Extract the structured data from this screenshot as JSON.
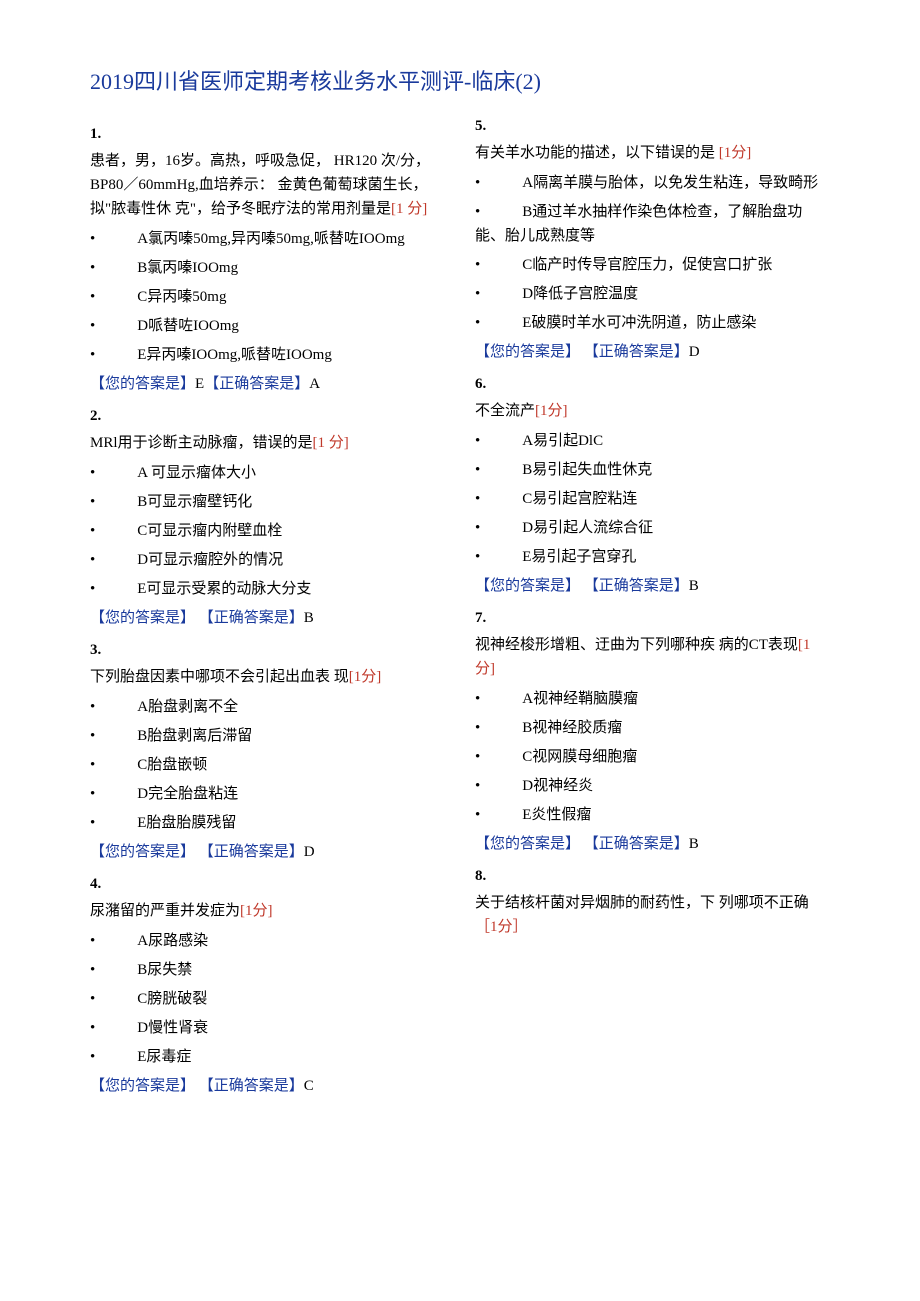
{
  "title": "2019四川省医师定期考核业务水平测评-临床(2)",
  "labels": {
    "your_answer": "【您的答案是】",
    "correct_answer": "【正确答案是】"
  },
  "questions": [
    {
      "num": "1.",
      "text_pre": "患者，男，16岁。高热，呼吸急促， HR120 次/分，BP80／60mmHg,血培养示： 金黄色葡萄球菌生长，拟\"脓毒性休 克\"，给予冬眠疗法的常用剂量是",
      "marks": "[1 分]",
      "options": [
        "A氯丙嗪50mg,异丙嗪50mg,哌替咗IOOmg",
        "B氯丙嗪IOOmg",
        "C异丙嗪50mg",
        "D哌替咗IOOmg",
        "E异丙嗪IOOmg,哌替咗IOOmg"
      ],
      "your": "E",
      "correct": "A"
    },
    {
      "num": "2.",
      "text_pre": "MRl用于诊断主动脉瘤，错误的是",
      "marks": "[1 分]",
      "options": [
        "A 可显示瘤体大小",
        "B可显示瘤壁钙化",
        "C可显示瘤内附壁血栓",
        "D可显示瘤腔外的情况",
        "E可显示受累的动脉大分支"
      ],
      "your": "",
      "correct": "B"
    },
    {
      "num": "3.",
      "text_pre": "下列胎盘因素中哪项不会引起出血表 现",
      "marks": "[1分]",
      "options": [
        "A胎盘剥离不全",
        "B胎盘剥离后滞留",
        "C胎盘嵌顿",
        "D完全胎盘粘连",
        "E胎盘胎膜残留"
      ],
      "your": "",
      "correct": "D"
    },
    {
      "num": "4.",
      "text_pre": "尿潴留的严重并发症为",
      "marks": "[1分]",
      "options": [
        "A尿路感染",
        "B尿失禁",
        "C膀胱破裂",
        "D慢性肾衰",
        "E尿毒症"
      ],
      "your": "",
      "correct": "C"
    },
    {
      "num": "5.",
      "text_pre": "有关羊水功能的描述，以下错误的是 ",
      "marks": "[1分]",
      "options": [
        "A隔离羊膜与胎体，以免发生粘连，导致畸形",
        "B通过羊水抽样作染色体检查，了解胎盘功能、胎儿成熟度等",
        "C临产时传导官腔压力，促使宫口扩张",
        "D降低子宫腔温度",
        "E破膜时羊水可冲洗阴道，防止感染"
      ],
      "your": "",
      "correct": "D"
    },
    {
      "num": "6.",
      "text_pre": "不全流产",
      "marks": "[1分]",
      "options": [
        "A易引起DlC",
        "B易引起失血性休克",
        "C易引起宫腔粘连",
        "D易引起人流综合征",
        "E易引起子宫穿孔"
      ],
      "your": "",
      "correct": "B"
    },
    {
      "num": "7.",
      "text_pre": "视神经梭形增粗、迂曲为下列哪种疾 病的CT表现",
      "marks": "[1分]",
      "options": [
        "A视神经鞘脑膜瘤",
        "B视神经胶质瘤",
        "C视网膜母细胞瘤",
        "D视神经炎",
        "E炎性假瘤"
      ],
      "your": "",
      "correct": "B"
    },
    {
      "num": "8.",
      "text_pre": "关于结核杆菌对异烟肺的耐药性，下 列哪项不正确",
      "marks": "［1分］",
      "options": [],
      "your": "",
      "correct": ""
    }
  ]
}
